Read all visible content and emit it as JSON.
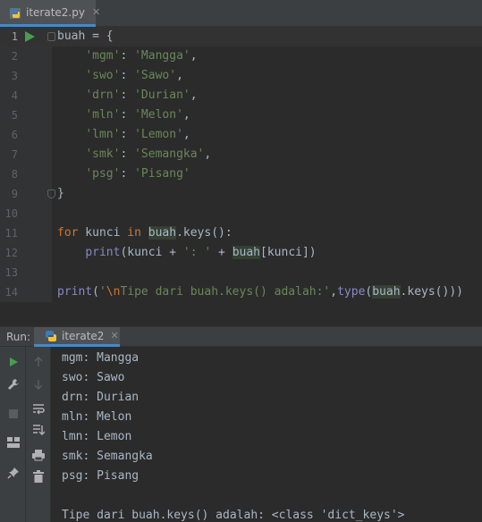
{
  "editor_tab": {
    "filename": "iterate2.py",
    "close": "✕"
  },
  "editor": {
    "lines": [
      {
        "num": "1",
        "segments": [
          [
            "buah",
            "id"
          ],
          [
            " = {",
            "p"
          ]
        ]
      },
      {
        "num": "2",
        "segments": [
          [
            "    ",
            "p"
          ],
          [
            "'mgm'",
            "s"
          ],
          [
            ": ",
            "p"
          ],
          [
            "'Mangga'",
            "s"
          ],
          [
            ",",
            "p"
          ]
        ]
      },
      {
        "num": "3",
        "segments": [
          [
            "    ",
            "p"
          ],
          [
            "'swo'",
            "s"
          ],
          [
            ": ",
            "p"
          ],
          [
            "'Sawo'",
            "s"
          ],
          [
            ",",
            "p"
          ]
        ]
      },
      {
        "num": "4",
        "segments": [
          [
            "    ",
            "p"
          ],
          [
            "'drn'",
            "s"
          ],
          [
            ": ",
            "p"
          ],
          [
            "'Durian'",
            "s"
          ],
          [
            ",",
            "p"
          ]
        ]
      },
      {
        "num": "5",
        "segments": [
          [
            "    ",
            "p"
          ],
          [
            "'mln'",
            "s"
          ],
          [
            ": ",
            "p"
          ],
          [
            "'Melon'",
            "s"
          ],
          [
            ",",
            "p"
          ]
        ]
      },
      {
        "num": "6",
        "segments": [
          [
            "    ",
            "p"
          ],
          [
            "'lmn'",
            "s"
          ],
          [
            ": ",
            "p"
          ],
          [
            "'Lemon'",
            "s"
          ],
          [
            ",",
            "p"
          ]
        ]
      },
      {
        "num": "7",
        "segments": [
          [
            "    ",
            "p"
          ],
          [
            "'smk'",
            "s"
          ],
          [
            ": ",
            "p"
          ],
          [
            "'Semangka'",
            "s"
          ],
          [
            ",",
            "p"
          ]
        ]
      },
      {
        "num": "8",
        "segments": [
          [
            "    ",
            "p"
          ],
          [
            "'psg'",
            "s"
          ],
          [
            ": ",
            "p"
          ],
          [
            "'Pisang'",
            "s"
          ]
        ]
      },
      {
        "num": "9",
        "segments": [
          [
            "}",
            "p"
          ]
        ]
      },
      {
        "num": "10",
        "segments": []
      },
      {
        "num": "11",
        "segments": [
          [
            "for",
            "k"
          ],
          [
            " kunci ",
            "p"
          ],
          [
            "in",
            "k"
          ],
          [
            " ",
            "p"
          ],
          [
            "buah",
            "h"
          ],
          [
            ".keys():",
            "p"
          ]
        ]
      },
      {
        "num": "12",
        "segments": [
          [
            "    ",
            "p"
          ],
          [
            "print",
            "f"
          ],
          [
            "(kunci + ",
            "p"
          ],
          [
            "': '",
            "s"
          ],
          [
            " + ",
            "p"
          ],
          [
            "buah",
            "h"
          ],
          [
            "[kunci])",
            "p"
          ]
        ]
      },
      {
        "num": "13",
        "segments": []
      },
      {
        "num": "14",
        "segments": [
          [
            "print",
            "f"
          ],
          [
            "(",
            "p"
          ],
          [
            "'",
            "s"
          ],
          [
            "\\n",
            "e"
          ],
          [
            "Tipe dari buah.keys() adalah:'",
            "s"
          ],
          [
            ",",
            "p"
          ],
          [
            "type",
            "f"
          ],
          [
            "(",
            "p"
          ],
          [
            "buah",
            "h"
          ],
          [
            ".keys()))",
            "p"
          ]
        ]
      }
    ]
  },
  "run_panel": {
    "label": "Run:",
    "tab_name": "iterate2",
    "close": "✕",
    "output": [
      "mgm: Mangga",
      "swo: Sawo",
      "drn: Durian",
      "mln: Melon",
      "lmn: Lemon",
      "smk: Semangka",
      "psg: Pisang",
      "",
      "Tipe dari buah.keys() adalah: <class 'dict_keys'>"
    ]
  },
  "icons": {
    "file_icon": "python-file-icon",
    "run_gutter": "run-arrow-icon",
    "toolbar": [
      "rerun-icon",
      "up-arrow-icon",
      "wrench-icon",
      "down-arrow-icon",
      "stop-icon",
      "soft-wrap-icon",
      "layout-icon",
      "scroll-to-end-icon",
      "print-icon",
      "pin-icon",
      "trash-icon"
    ]
  },
  "colors": {
    "background": "#2b2b2b",
    "keyword": "#cc7832",
    "string": "#6a8759",
    "builtin": "#8888c6",
    "text": "#a9b7c6",
    "run_green": "#499c54",
    "accent": "#4a88c7"
  }
}
